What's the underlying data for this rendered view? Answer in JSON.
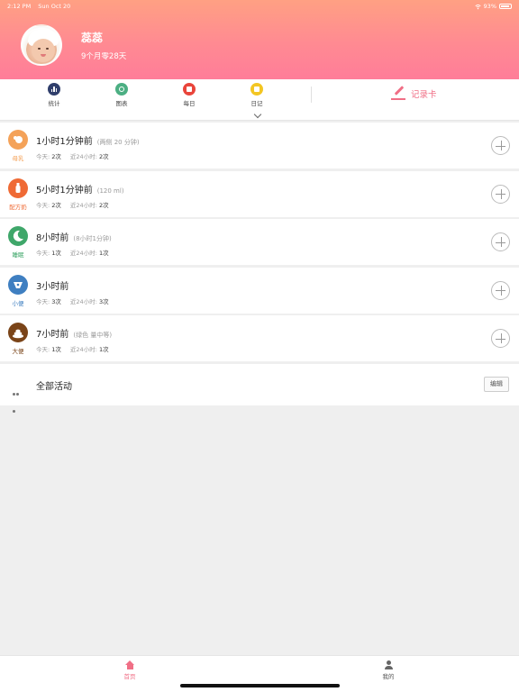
{
  "status_bar": {
    "time": "2:12 PM",
    "date": "Sun Oct 20",
    "battery": "93%"
  },
  "profile": {
    "name": "蕊蕊",
    "age": "9个月零28天"
  },
  "toolbar": {
    "items": [
      {
        "label": "统计",
        "icon": "bar-chart-icon",
        "color": "#2f3e6b"
      },
      {
        "label": "图表",
        "icon": "clock-icon",
        "color": "#4caf83"
      },
      {
        "label": "每日",
        "icon": "document-icon",
        "color": "#e9453b"
      },
      {
        "label": "日记",
        "icon": "note-icon",
        "color": "#f3c623"
      }
    ],
    "record_card_label": "记录卡"
  },
  "activities": [
    {
      "category": "母乳",
      "color": "#f4a259",
      "icon": "breastfeed-icon",
      "title": "1小时1分钟前",
      "detail": "(两侧 20 分钟)",
      "today_label": "今天:",
      "today_value": "2次",
      "last24_label": "近24小时:",
      "last24_value": "2次"
    },
    {
      "category": "配方奶",
      "color": "#ef6a35",
      "icon": "bottle-icon",
      "title": "5小时1分钟前",
      "detail": "(120 ml)",
      "today_label": "今天:",
      "today_value": "2次",
      "last24_label": "近24小时:",
      "last24_value": "2次"
    },
    {
      "category": "睡眠",
      "color": "#3fa76a",
      "icon": "moon-icon",
      "title": "8小时前",
      "detail": "(8小时1分钟)",
      "today_label": "今天:",
      "today_value": "1次",
      "last24_label": "近24小时:",
      "last24_value": "1次"
    },
    {
      "category": "小便",
      "color": "#3f7fc1",
      "icon": "diaper-wet-icon",
      "title": "3小时前",
      "detail": "",
      "today_label": "今天:",
      "today_value": "3次",
      "last24_label": "近24小时:",
      "last24_value": "3次"
    },
    {
      "category": "大便",
      "color": "#7a4418",
      "icon": "poop-icon",
      "title": "7小时前",
      "detail": "(绿色 量中等)",
      "today_label": "今天:",
      "today_value": "1次",
      "last24_label": "近24小时:",
      "last24_value": "1次"
    }
  ],
  "all_activities": {
    "label": "全部活动",
    "edit_label": "编辑"
  },
  "tabbar": {
    "home_label": "首页",
    "me_label": "我的",
    "accent": "#f06f86"
  }
}
